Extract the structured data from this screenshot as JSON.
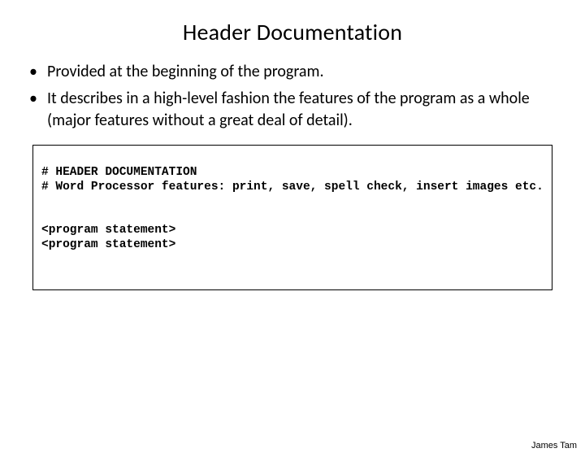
{
  "title": "Header Documentation",
  "bullets": [
    "Provided at the beginning of the program.",
    "It describes in a high-level fashion the features of the program as a whole (major features without a great deal of detail)."
  ],
  "code": {
    "line1": "# HEADER DOCUMENTATION",
    "line2": "# Word Processor features: print, save, spell check, insert images etc.",
    "line3": "<program statement>",
    "line4": "<program statement>"
  },
  "footer": "James Tam"
}
